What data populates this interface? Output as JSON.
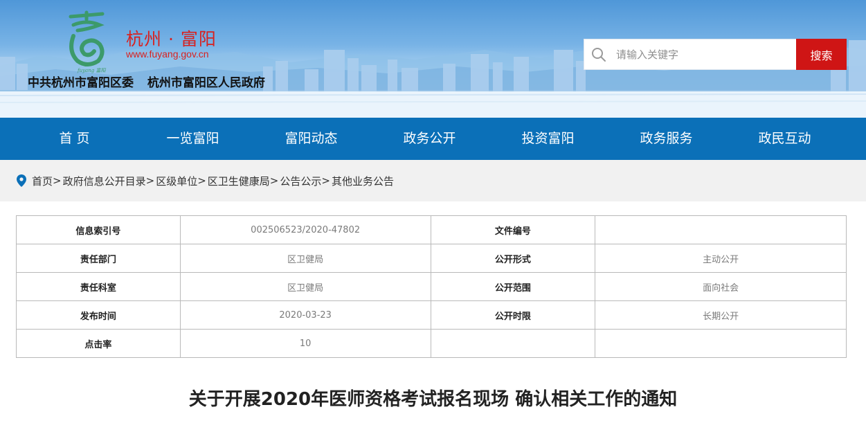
{
  "header": {
    "site_name": "杭州 · 富阳",
    "site_url": "www.fuyang.gov.cn",
    "logo_caption": "fuyang 富阳",
    "gov_names": [
      "中共杭州市富阳区委",
      "杭州市富阳区人民政府"
    ],
    "search": {
      "placeholder": "请输入关键字",
      "button_label": "搜索"
    }
  },
  "nav": {
    "items": [
      "首 页",
      "一览富阳",
      "富阳动态",
      "政务公开",
      "投资富阳",
      "政务服务",
      "政民互动"
    ]
  },
  "breadcrumb": {
    "items": [
      "首页",
      "政府信息公开目录",
      "区级单位",
      "区卫生健康局",
      "公告公示",
      "其他业务公告"
    ],
    "separator": ">"
  },
  "info_table": {
    "rows": [
      {
        "k1": "信息索引号",
        "v1": "002506523/2020-47802",
        "k2": "文件编号",
        "v2": ""
      },
      {
        "k1": "责任部门",
        "v1": "区卫健局",
        "k2": "公开形式",
        "v2": "主动公开"
      },
      {
        "k1": "责任科室",
        "v1": "区卫健局",
        "k2": "公开范围",
        "v2": "面向社会"
      },
      {
        "k1": "发布时间",
        "v1": "2020-03-23",
        "k2": "公开时限",
        "v2": "长期公开"
      },
      {
        "k1": "点击率",
        "v1": "10",
        "k2": "",
        "v2": ""
      }
    ]
  },
  "document": {
    "title": "关于开展2020年医师资格考试报名现场 确认相关工作的通知"
  },
  "colors": {
    "nav_bg": "#0b70b8",
    "accent_red": "#cf1515",
    "brand_red": "#d8211f",
    "logo_green": "#3c9a6a"
  }
}
